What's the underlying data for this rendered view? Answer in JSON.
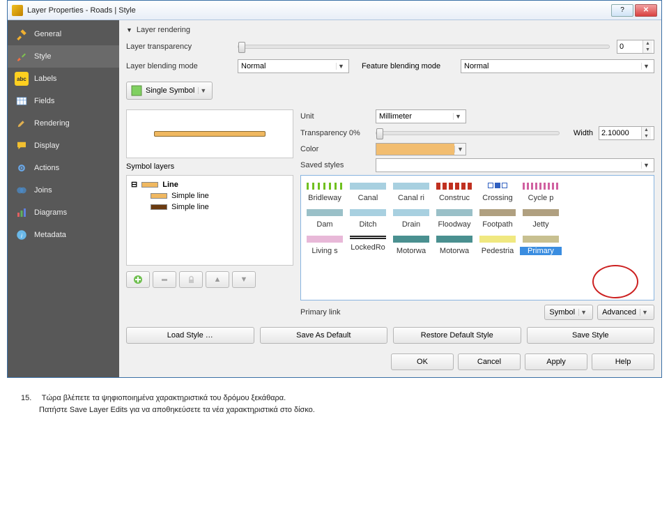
{
  "window": {
    "title": "Layer Properties - Roads | Style"
  },
  "sidebar": {
    "items": [
      {
        "label": "General",
        "icon": "tools"
      },
      {
        "label": "Style",
        "icon": "brush",
        "selected": true
      },
      {
        "label": "Labels",
        "icon": "abc"
      },
      {
        "label": "Fields",
        "icon": "table"
      },
      {
        "label": "Rendering",
        "icon": "paint"
      },
      {
        "label": "Display",
        "icon": "bubble"
      },
      {
        "label": "Actions",
        "icon": "gear"
      },
      {
        "label": "Joins",
        "icon": "join"
      },
      {
        "label": "Diagrams",
        "icon": "chart"
      },
      {
        "label": "Metadata",
        "icon": "info"
      }
    ]
  },
  "rendering_section": "Layer rendering",
  "transparency": {
    "label": "Layer transparency",
    "value": "0"
  },
  "blending": {
    "label": "Layer blending mode",
    "value": "Normal",
    "flabel": "Feature blending mode",
    "fvalue": "Normal"
  },
  "symboltype": {
    "label": "Single Symbol"
  },
  "unit": {
    "label": "Unit",
    "value": "Millimeter"
  },
  "linetrans": {
    "label": "Transparency 0%"
  },
  "width": {
    "label": "Width",
    "value": "2.10000"
  },
  "color": {
    "label": "Color"
  },
  "saved": {
    "label": "Saved styles"
  },
  "symbol_layers": {
    "label": "Symbol layers",
    "root": "Line",
    "children": [
      "Simple line",
      "Simple line"
    ]
  },
  "styles": {
    "row1": [
      "Bridleway",
      "Canal",
      "Canal ri",
      "Construc",
      "Crossing",
      "Cycle p"
    ],
    "row2": [
      "Dam",
      "Ditch",
      "Drain",
      "Floodway",
      "Footpath",
      "Jetty"
    ],
    "row3": [
      "Living s",
      "LockedRo",
      "Motorwa",
      "Motorwa",
      "Pedestria",
      "Primary"
    ]
  },
  "primary_link": "Primary link",
  "symbol_btn": "Symbol",
  "advanced_btn": "Advanced",
  "stylebtns": [
    "Load Style …",
    "Save As Default",
    "Restore Default Style",
    "Save Style"
  ],
  "dlg": [
    "OK",
    "Cancel",
    "Apply",
    "Help"
  ],
  "caption": {
    "num": "15.",
    "line1": "Τώρα βλέπετε τα ψηφιοποιημένα χαρακτηριστικά του δρόμου ξεκάθαρα.",
    "line2": "Πατήστε Save Layer Edits για να αποθηκεύσετε τα νέα χαρακτηριστικά στο δίσκο."
  }
}
